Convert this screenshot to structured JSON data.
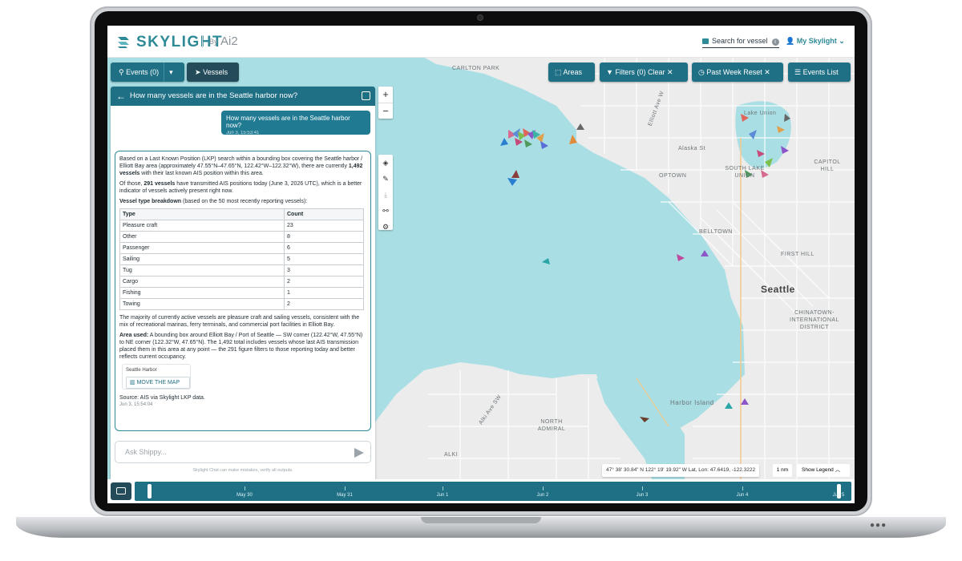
{
  "app": {
    "brand": "SKYLIGHT",
    "by": "By",
    "partner": "Ai2"
  },
  "header": {
    "search_label": "Search for vessel",
    "user_label": "My Skylight"
  },
  "toolbar": {
    "events_label": "Events (0)",
    "vessels_label": "Vessels",
    "areas_label": "Areas",
    "filters_label": "Filters (0)",
    "filters_clear": "Clear",
    "time_label": "Past Week",
    "time_reset": "Reset",
    "events_list_label": "Events List"
  },
  "chat": {
    "title": "How many vessels are in the Seattle harbor now?",
    "user_message": "How many vessels are in the Seattle harbor now?",
    "user_timestamp": "Jun 3, 15:53:41",
    "answer_p1_a": "Based on a Last Known Position (LKP) search within a bounding box covering the Seattle harbor / Elliott Bay area (approximately 47.55°N–47.65°N, 122.42°W–122.32°W), there are currently ",
    "answer_p1_b": "1,492 vessels",
    "answer_p1_c": " with their last known AIS position within this area.",
    "answer_p2_a": "Of those, ",
    "answer_p2_b": "291 vessels",
    "answer_p2_c": " have transmitted AIS positions today (June 3, 2026 UTC), which is a better indicator of vessels actively present right now.",
    "breakdown_title": "Vessel type breakdown",
    "breakdown_note": " (based on the 50 most recently reporting vessels):",
    "table_headers": [
      "Type",
      "Count"
    ],
    "table_rows": [
      [
        "Pleasure craft",
        "23"
      ],
      [
        "Other",
        "8"
      ],
      [
        "Passenger",
        "6"
      ],
      [
        "Sailing",
        "5"
      ],
      [
        "Tug",
        "3"
      ],
      [
        "Cargo",
        "2"
      ],
      [
        "Fishing",
        "1"
      ],
      [
        "Towing",
        "2"
      ]
    ],
    "answer_p3": "The majority of currently active vessels are pleasure craft and sailing vessels, consistent with the mix of recreational marinas, ferry terminals, and commercial port facilities in Elliott Bay.",
    "area_title": "Area used:",
    "area_text": " A bounding box around Elliott Bay / Port of Seattle — SW corner (122.42°W, 47.55°N) to NE corner (122.32°W, 47.65°N). The 1,492 total includes vessels whose last AIS transmission placed them in this area at any point — the 291 figure filters to those reporting today and better reflects current occupancy.",
    "area_card_title": "Seattle Harbor",
    "move_map_label": "MOVE THE MAP",
    "source": "Source: AIS via Skylight LKP data.",
    "answer_timestamp": "Jun 3, 15:54:04",
    "input_placeholder": "Ask Shippy...",
    "disclaimer": "Skylight Chat can make mistakes, verify all outputs."
  },
  "map": {
    "coords": "47° 38' 30.84\" N 122° 19' 19.92\" W  Lat, Lon: 47.6419, -122.3222",
    "scale": "1 nm",
    "legend_label": "Show Legend",
    "labels": [
      "CARLTON PARK",
      "Seattle",
      "BELLTOWN",
      "FIRST HILL",
      "CHINATOWN-INTERNATIONAL DISTRICT",
      "SOUTH LAKE UNION",
      "Harbor Island",
      "NORTH ADMIRAL",
      "ALKI",
      "OPTOWN",
      "CAPITOL HILL",
      "Lake Union",
      "Alki Ave SW",
      "Alaska St",
      "Elliott Ave W"
    ]
  },
  "timeline": {
    "labels": [
      "May 30",
      "May 31",
      "Jun 1",
      "Jun 2",
      "Jun 3",
      "Jun 4",
      "Jun 5"
    ]
  },
  "colors": {
    "accent": "#1f6f85",
    "brand": "#2e8a97",
    "water": "#a9dfe4",
    "land": "#ececec"
  }
}
